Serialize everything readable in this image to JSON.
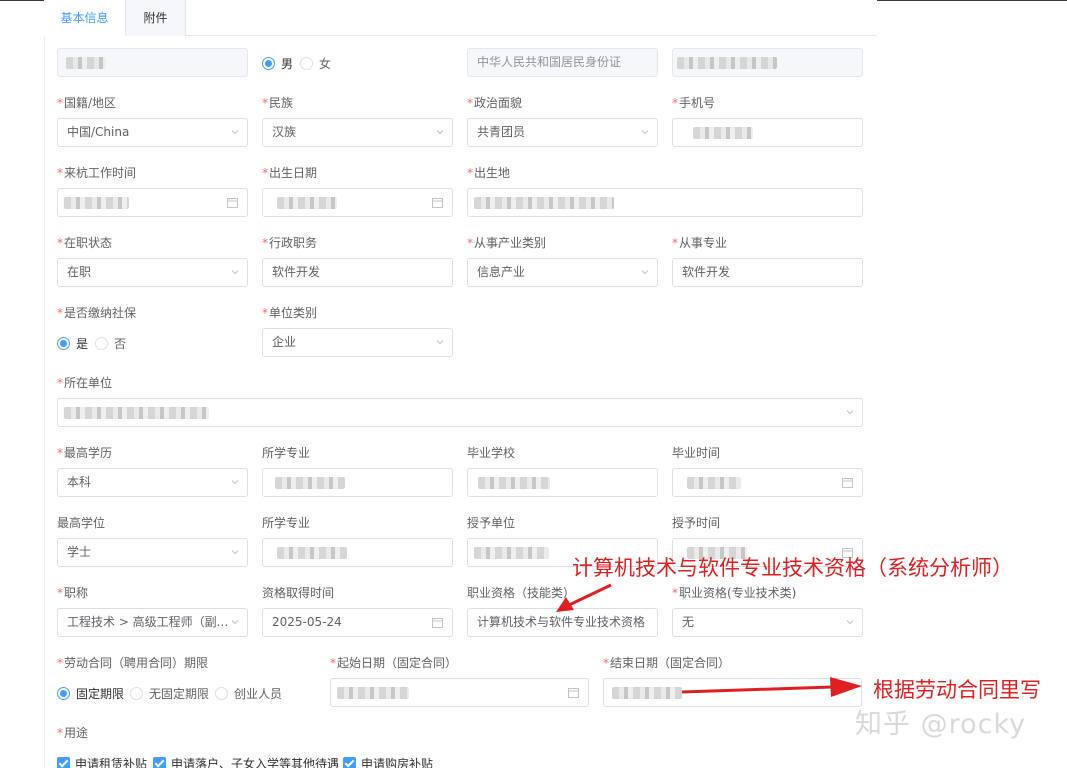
{
  "tabs": {
    "basic": "基本信息",
    "attachment": "附件"
  },
  "identity": {
    "gender_male": "男",
    "gender_female": "女",
    "id_type": "中华人民共和国居民身份证"
  },
  "row1": {
    "nationality_label": "国籍/地区",
    "nationality_value": "中国/China",
    "ethnicity_label": "民族",
    "ethnicity_value": "汉族",
    "political_label": "政治面貌",
    "political_value": "共青团员",
    "phone_label": "手机号"
  },
  "row2": {
    "work_time_label": "来杭工作时间",
    "birth_date_label": "出生日期",
    "birth_place_label": "出生地"
  },
  "row3": {
    "job_status_label": "在职状态",
    "job_status_value": "在职",
    "admin_post_label": "行政职务",
    "admin_post_value": "软件开发",
    "industry_label": "从事产业类别",
    "industry_value": "信息产业",
    "major_label": "从事专业",
    "major_value": "软件开发"
  },
  "row4": {
    "social_label": "是否缴纳社保",
    "social_yes": "是",
    "social_no": "否",
    "unit_type_label": "单位类别",
    "unit_type_value": "企业"
  },
  "row5": {
    "employer_label": "所在单位"
  },
  "row6": {
    "edu_label": "最高学历",
    "edu_value": "本科",
    "edu_major_label": "所学专业",
    "school_label": "毕业学校",
    "grad_time_label": "毕业时间"
  },
  "row7": {
    "degree_label": "最高学位",
    "degree_value": "学士",
    "degree_major_label": "所学专业",
    "grant_unit_label": "授予单位",
    "grant_time_label": "授予时间"
  },
  "row8": {
    "title_label": "职称",
    "title_value": "工程技术 > 高级工程师（副...",
    "cert_time_label": "资格取得时间",
    "cert_time_value": "2025-05-24",
    "skill_label": "职业资格（技能类）",
    "skill_value": "计算机技术与软件专业技术资格",
    "prof_label": "职业资格(专业技术类)",
    "prof_value": "无"
  },
  "row9": {
    "contract_label": "劳动合同（聘用合同）期限",
    "contract_fixed": "固定期限",
    "contract_open": "无固定期限",
    "contract_startup": "创业人员",
    "start_label": "起始日期（固定合同）",
    "end_label": "结束日期（固定合同）"
  },
  "row10": {
    "purpose_label": "用途",
    "purpose_rent": "申请租赁补贴",
    "purpose_hukou": "申请落户、子女入学等其他待遇",
    "purpose_house": "申请购房补贴"
  },
  "annotations": {
    "cert_note": "计算机技术与软件专业技术资格（系统分析师）",
    "contract_note": "根据劳动合同里写",
    "watermark": "知乎 @rocky"
  },
  "colors": {
    "primary": "#409eff",
    "required": "#f56c6c",
    "annotation": "#e02020"
  }
}
